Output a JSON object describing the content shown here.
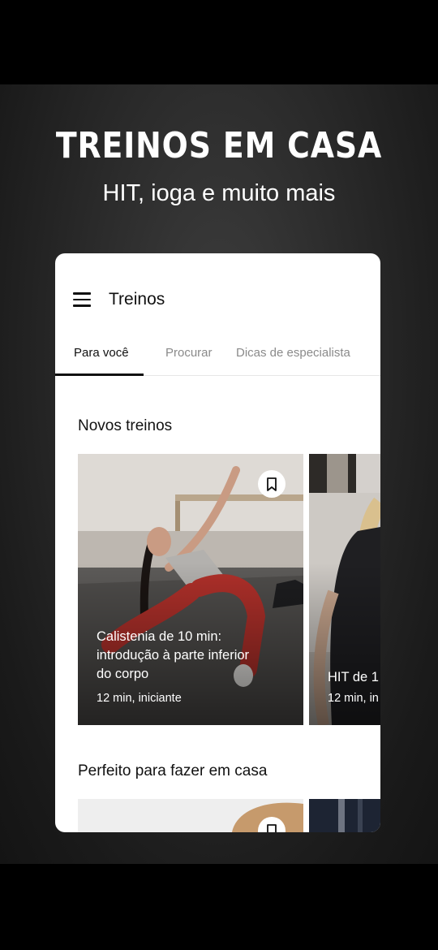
{
  "promo": {
    "title": "TREINOS EM CASA",
    "subtitle": "HIT, ioga e muito mais"
  },
  "app": {
    "title": "Treinos",
    "menu_icon": "hamburger-menu-icon",
    "tabs": [
      {
        "label": "Para você",
        "active": true
      },
      {
        "label": "Procurar",
        "active": false
      },
      {
        "label": "Dicas de especialista",
        "active": false
      }
    ]
  },
  "sections": [
    {
      "title": "Novos treinos",
      "cards": [
        {
          "title": "Calistenia de 10 min: introdução à parte inferior do corpo",
          "meta": "12 min, iniciante",
          "icon": "bookmark-icon"
        },
        {
          "title": "HIT de 1",
          "meta": "12 min, in"
        }
      ]
    },
    {
      "title": "Perfeito para fazer em casa",
      "cards": [
        {
          "icon": "bookmark-icon"
        },
        {}
      ]
    }
  ],
  "colors": {
    "background": "#2c2c2c",
    "card_surface": "#ffffff",
    "text_primary": "#111111",
    "tab_inactive": "#8a8a8a"
  }
}
